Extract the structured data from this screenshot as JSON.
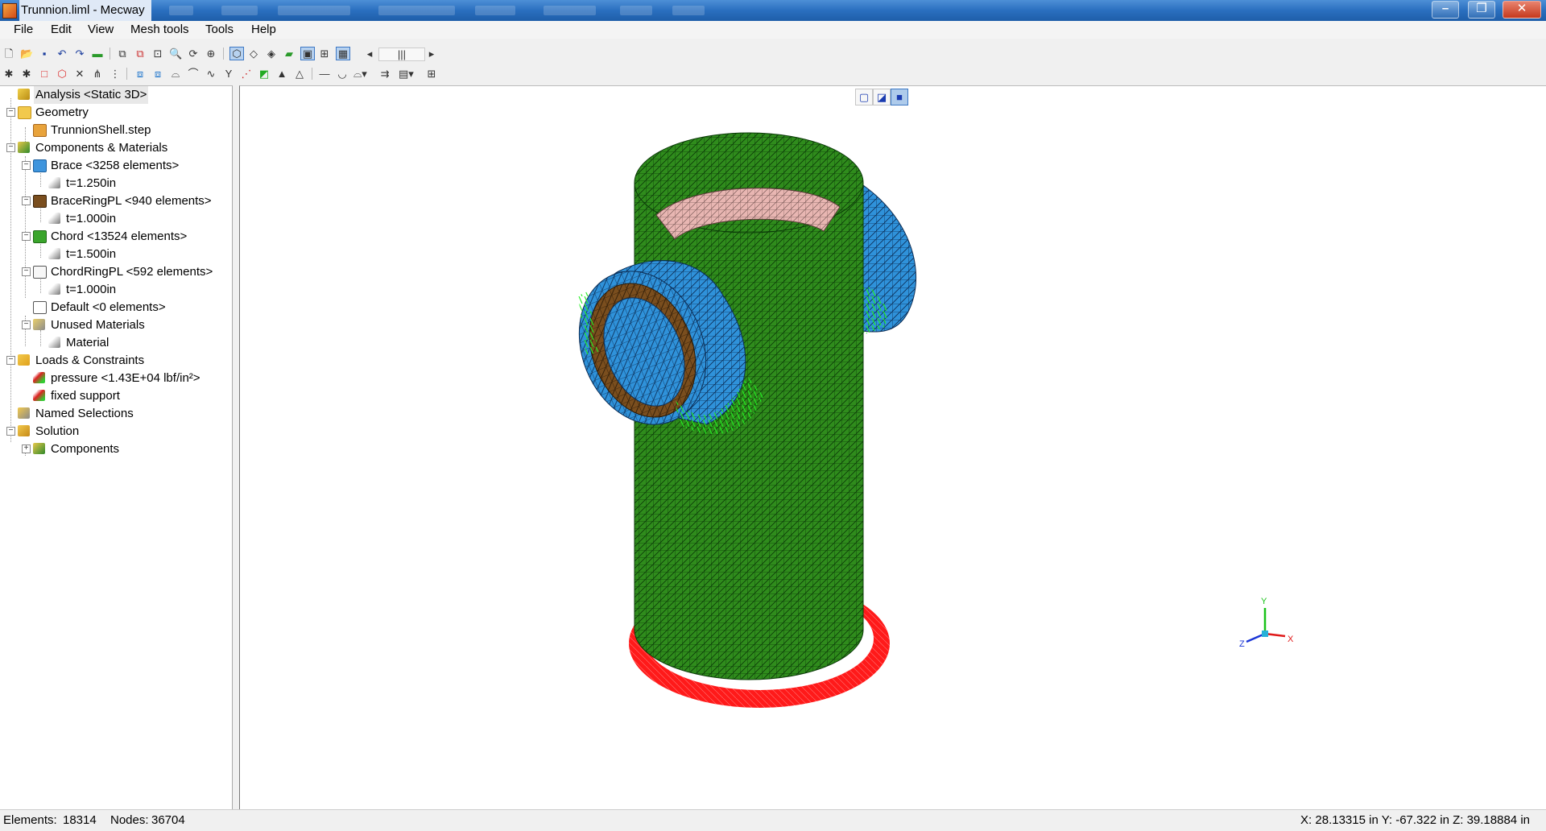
{
  "window": {
    "title": "Trunnion.liml - Mecway",
    "minimize_icon": "minimize-icon",
    "maximize_icon": "restore-icon",
    "close_icon": "close-icon"
  },
  "menu": [
    "File",
    "Edit",
    "View",
    "Mesh tools",
    "Tools",
    "Help"
  ],
  "tree": {
    "analysis": "Analysis <Static 3D>",
    "geometry": "Geometry",
    "geometry_file": "TrunnionShell.step",
    "components": "Components & Materials",
    "brace": "Brace <3258 elements>",
    "brace_t": "t=1.250in",
    "bracering": "BraceRingPL <940 elements>",
    "bracering_t": "t=1.000in",
    "chord": "Chord <13524 elements>",
    "chord_t": "t=1.500in",
    "chordring": "ChordRingPL <592 elements>",
    "chordring_t": "t=1.000in",
    "default": "Default <0 elements>",
    "unused": "Unused Materials",
    "material": "Material",
    "loads": "Loads & Constraints",
    "pressure": "pressure <1.43E+04 lbf/in²>",
    "fixed": "fixed support",
    "named": "Named Selections",
    "solution": "Solution",
    "solution_components": "Components"
  },
  "triad": {
    "x": "X",
    "y": "Y",
    "z": "Z"
  },
  "status": {
    "elements_label": "Elements:",
    "elements_value": "18314",
    "nodes_label": "Nodes:",
    "nodes_value": "36704",
    "coordinates": "X: 28.13315 in Y: -67.322 in Z: 39.18884 in"
  },
  "colors": {
    "chord": "#2e8b1a",
    "brace": "#2f8fd6",
    "brace_ring": "#7a4e1e",
    "chord_ring_inner": "#e8b4b0",
    "fixed_support": "#ff1a1a",
    "pressure_arrows": "#33ff33"
  }
}
